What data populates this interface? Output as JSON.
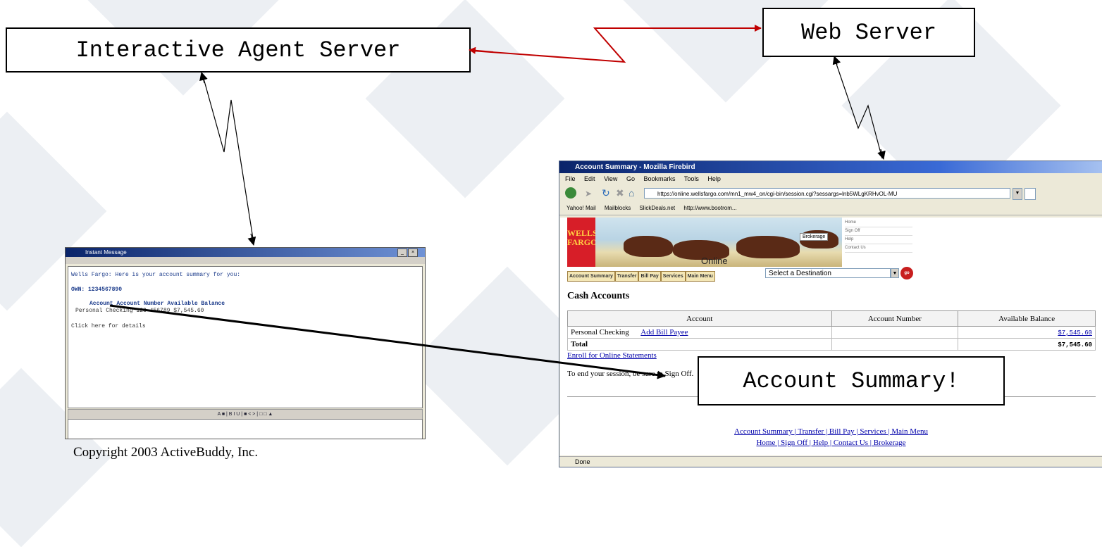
{
  "diagram": {
    "nodes": {
      "agent_server": "Interactive Agent Server",
      "web_server": "Web Server",
      "callout": "Account Summary!"
    },
    "copyright": "Copyright 2003 ActiveBuddy, Inc.",
    "colors": {
      "link_red": "#c00000",
      "line": "#000000"
    }
  },
  "im_window": {
    "title": "Instant Message",
    "chat_lines": [
      "Wells Fargo: Here is your account summary for you:",
      "OWN: 1234567890",
      "Account          Account Number    Available Balance",
      "Personal Checking  123-456789         $7,545.60",
      "Click here for details"
    ],
    "link_word": "here"
  },
  "browser": {
    "title": "Account Summary - Mozilla Firebird",
    "menu": [
      "File",
      "Edit",
      "View",
      "Go",
      "Bookmarks",
      "Tools",
      "Help"
    ],
    "url": "https://online.wellsfargo.com/mn1_mw4_on/cgi-bin/session.cgi?sessargs=lnb5WLgKRHvOL-MU",
    "bookmarks": [
      "Yahoo! Mail",
      "Mailblocks",
      "SlickDeals.net",
      "http://www.bootrom..."
    ],
    "bank": {
      "logo_line1": "WELLS",
      "logo_line2": "FARGO",
      "online": "Online",
      "brokerage_btn": "Brokerage",
      "side_links": [
        "Home",
        "Sign Off",
        "Help",
        "Contact Us"
      ],
      "tabs": [
        "Account Summary",
        "Transfer",
        "Bill Pay",
        "Services",
        "Main Menu"
      ],
      "destination": "Select a Destination",
      "go": "go"
    },
    "section_title": "Cash Accounts",
    "table": {
      "headers": [
        "Account",
        "Account Number",
        "Available Balance"
      ],
      "row_name": "Personal Checking",
      "row_link": "Add Bill Payee",
      "row_balance": "$7,545.60",
      "total_label": "Total",
      "total_balance": "$7,545.60"
    },
    "enroll_link": "Enroll for Online Statements",
    "signoff_note": "To end your session, be sure to Sign Off.",
    "footer_links_1": "Account Summary | Transfer | Bill Pay | Services | Main Menu",
    "footer_links_2": "Home | Sign Off | Help | Contact Us | Brokerage",
    "status": "Done"
  }
}
